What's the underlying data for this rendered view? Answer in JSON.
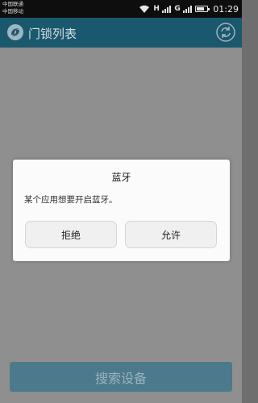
{
  "status_bar": {
    "carrier_1": "中国联通",
    "carrier_2": "中国移动",
    "network_1": "H",
    "network_2": "G",
    "time": "01:29",
    "battery_level": 0.7
  },
  "header": {
    "title": "门锁列表",
    "logo_icon": "app-logo-icon",
    "refresh_icon": "refresh-icon"
  },
  "dialog": {
    "title": "蓝牙",
    "message": "某个应用想要开启蓝牙。",
    "deny_label": "拒绝",
    "allow_label": "允许"
  },
  "main": {
    "search_button_label": "搜索设备"
  }
}
